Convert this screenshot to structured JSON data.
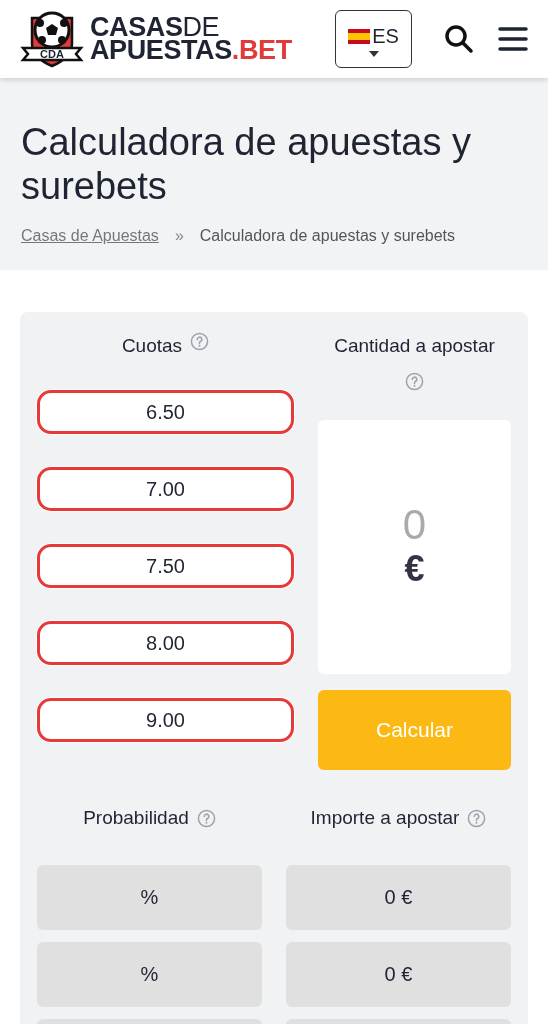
{
  "header": {
    "logo_badge": "CDA",
    "logo_line_1": "**CASAS**DE",
    "logo_line_2": "APUESTAS",
    "logo_suffix": ".BET",
    "language": "ES"
  },
  "title": "Calculadora de apuestas y surebets",
  "breadcrumb": [
    {
      "label": "Casas de Apuestas",
      "kind": "link"
    },
    {
      "label": "»",
      "kind": "separator"
    },
    {
      "label": "Calculadora de apuestas y surebets",
      "kind": "current"
    }
  ],
  "calculator": {
    "odds_label": "Cuotas",
    "stake_label": "Cantidad a apostar",
    "odds": [
      {
        "value": "6.50",
        "invalid": true
      },
      {
        "value": "7.00",
        "invalid": true
      },
      {
        "value": "7.50",
        "invalid": true
      },
      {
        "value": "8.00",
        "invalid": true
      },
      {
        "value": "9.00",
        "invalid": true
      }
    ],
    "stake_value": "0",
    "currency": "€",
    "calculate_button": "Calcular",
    "probability_label": "Probabilidad",
    "amount_label": "Importe a apostar",
    "results": [
      {
        "probability": "%",
        "amount": "0 €"
      },
      {
        "probability": "%",
        "amount": "0 €"
      }
    ]
  }
}
